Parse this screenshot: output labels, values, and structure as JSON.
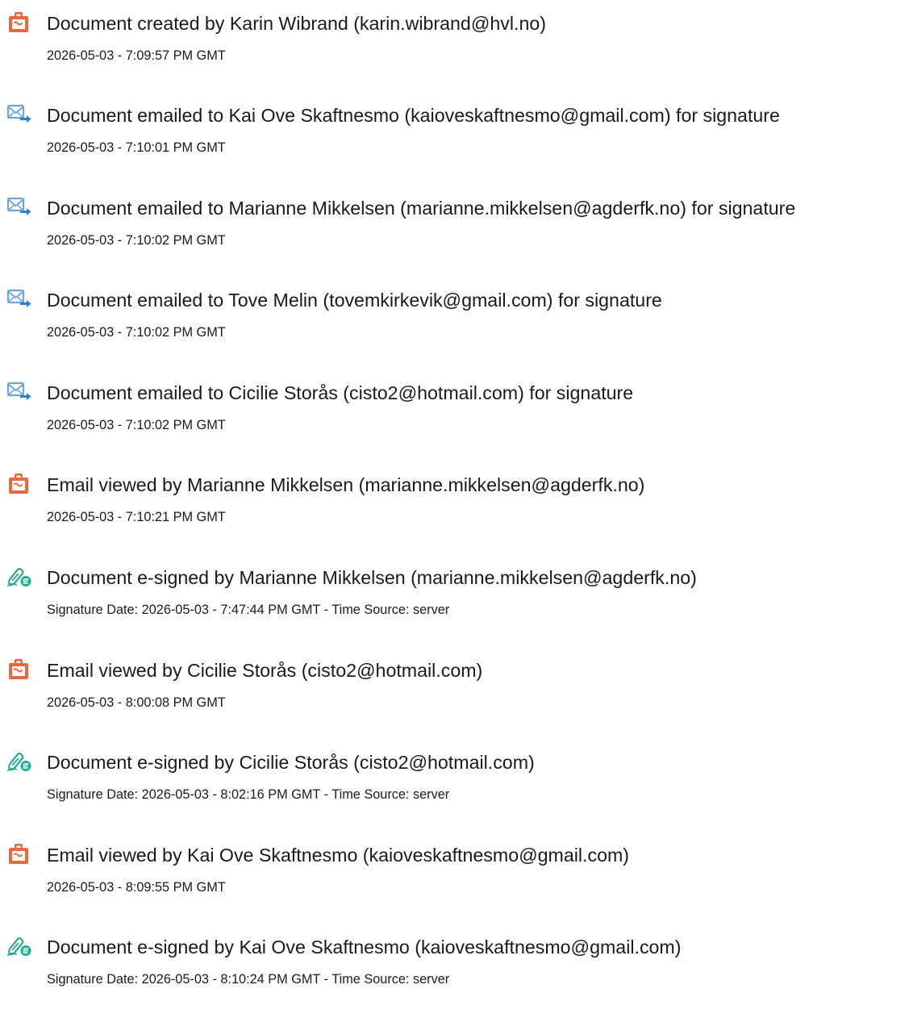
{
  "events": [
    {
      "icon": "document-icon",
      "title": "Document created by Karin Wibrand (karin.wibrand@hvl.no)",
      "detail": "2026-05-03 - 7:09:57 PM GMT"
    },
    {
      "icon": "email-sent-icon",
      "title": "Document emailed to Kai Ove Skaftnesmo (kaioveskaftnesmo@gmail.com) for signature",
      "detail": "2026-05-03 - 7:10:01 PM GMT"
    },
    {
      "icon": "email-sent-icon",
      "title": "Document emailed to Marianne Mikkelsen (marianne.mikkelsen@agderfk.no) for signature",
      "detail": "2026-05-03 - 7:10:02 PM GMT"
    },
    {
      "icon": "email-sent-icon",
      "title": "Document emailed to Tove Melin (tovemkirkevik@gmail.com) for signature",
      "detail": "2026-05-03 - 7:10:02 PM GMT"
    },
    {
      "icon": "email-sent-icon",
      "title": "Document emailed to Cicilie Storås (cisto2@hotmail.com) for signature",
      "detail": "2026-05-03 - 7:10:02 PM GMT"
    },
    {
      "icon": "document-icon",
      "title": "Email viewed by Marianne Mikkelsen (marianne.mikkelsen@agderfk.no)",
      "detail": "2026-05-03 - 7:10:21 PM GMT"
    },
    {
      "icon": "e-sign-pen-icon",
      "title": "Document e-signed by Marianne Mikkelsen (marianne.mikkelsen@agderfk.no)",
      "detail": "Signature Date: 2026-05-03 - 7:47:44 PM GMT - Time Source: server"
    },
    {
      "icon": "document-icon",
      "title": "Email viewed by Cicilie Storås (cisto2@hotmail.com)",
      "detail": "2026-05-03 - 8:00:08 PM GMT"
    },
    {
      "icon": "e-sign-pen-icon",
      "title": "Document e-signed by Cicilie Storås (cisto2@hotmail.com)",
      "detail": "Signature Date: 2026-05-03 - 8:02:16 PM GMT - Time Source: server"
    },
    {
      "icon": "document-icon",
      "title": "Email viewed by Kai Ove Skaftnesmo (kaioveskaftnesmo@gmail.com)",
      "detail": "2026-05-03 - 8:09:55 PM GMT"
    },
    {
      "icon": "e-sign-pen-icon",
      "title": "Document e-signed by Kai Ove Skaftnesmo (kaioveskaftnesmo@gmail.com)",
      "detail": "Signature Date: 2026-05-03 - 8:10:24 PM GMT - Time Source: server"
    }
  ],
  "colors": {
    "document_icon": "#e8693f",
    "email_icon": "#6fa3e0",
    "email_arrow": "#2b7fd4",
    "sign_pen": "#2aa78e",
    "sign_badge": "#1fae8c",
    "text": "#1a1a1a"
  }
}
